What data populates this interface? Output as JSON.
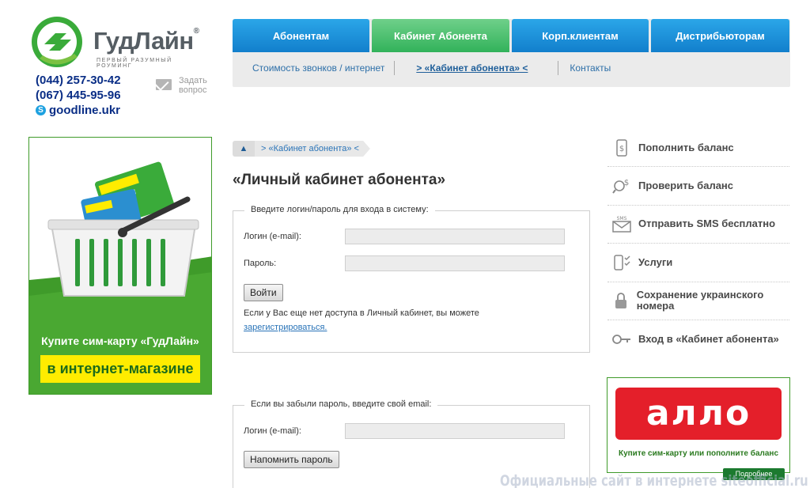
{
  "brand": {
    "name": "ГудЛайн",
    "reg_mark": "®",
    "tagline": "первый разумный роуминг",
    "primary_color": "#3aab3a",
    "nav_blue": "#1a8ad8",
    "nav_green": "#3dbb63"
  },
  "contacts": {
    "phone1": "(044) 257-30-42",
    "phone2": "(067) 445-95-96",
    "skype_icon": "skype-icon",
    "skype": "goodline.ukr",
    "ask_icon": "envelope-icon",
    "ask": "Задать вопрос"
  },
  "nav": {
    "tabs": [
      {
        "label": "Абонентам"
      },
      {
        "label": "Кабинет Абонента"
      },
      {
        "label": "Корп.клиентам"
      },
      {
        "label": "Дистрибьюторам"
      }
    ],
    "active_tab": "Кабинет Абонента",
    "sub": [
      {
        "label": "Стоимость звонков / интернет"
      },
      {
        "label": "> «Кабинет абонента» <"
      },
      {
        "label": "Контакты"
      }
    ]
  },
  "promo_left": {
    "text": "Купите сим-карту «ГудЛайн»",
    "cta": "в интернет-магазине"
  },
  "breadcrumb": {
    "home_icon": "home-icon",
    "current": "> «Кабинет абонента» <"
  },
  "page": {
    "title": "«Личный кабинет абонента»"
  },
  "login_form": {
    "legend": "Введите логин/пароль для входа в систему:",
    "login_label": "Логин (e-mail):",
    "login_value": "",
    "password_label": "Пароль:",
    "password_value": "",
    "submit": "Войти",
    "note": "Если у Вас еще нет доступа в Личный кабинет, вы можете",
    "register_link": "зарегистрироваться."
  },
  "recover_form": {
    "legend": "Если вы забыли пароль, введите свой email:",
    "login_label": "Логин (e-mail):",
    "login_value": "",
    "submit": "Напомнить пароль"
  },
  "sidebar": {
    "items": [
      {
        "label": "Пополнить баланс",
        "icon": "wallet-icon"
      },
      {
        "label": "Проверить баланс",
        "icon": "balance-search-icon"
      },
      {
        "label": "Отправить SMS бесплатно",
        "icon": "sms-icon"
      },
      {
        "label": "Услуги",
        "icon": "phone-services-icon"
      },
      {
        "label": "Сохранение украинского номера",
        "icon": "lock-icon"
      },
      {
        "label": "Вход в «Кабинет абонента»",
        "icon": "key-icon"
      }
    ]
  },
  "promo_right": {
    "brand": "аллo",
    "text": "Купите сим-карту или пополните баланс",
    "more": "Подробнее"
  },
  "watermark": "Официальные сайт в интернете siteofficial.ru"
}
